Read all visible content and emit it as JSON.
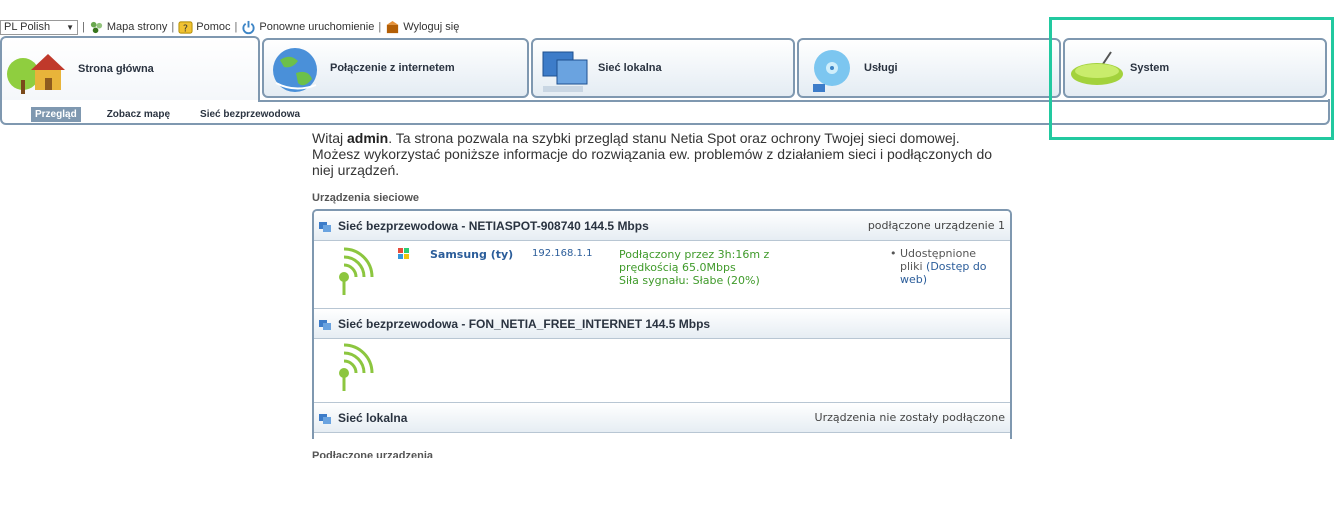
{
  "topbar": {
    "language": "PL Polish",
    "links": [
      {
        "label": "Mapa strony",
        "icon": "sitemap-icon"
      },
      {
        "label": "Pomoc",
        "icon": "help-icon"
      },
      {
        "label": "Ponowne uruchomienie",
        "icon": "power-icon"
      },
      {
        "label": "Wyloguj się",
        "icon": "logout-icon"
      }
    ]
  },
  "tabs": [
    {
      "label": "Strona główna",
      "icon": "home-icon",
      "active": true
    },
    {
      "label": "Połączenie z internetem",
      "icon": "globe-icon"
    },
    {
      "label": "Sieć lokalna",
      "icon": "local-network-icon"
    },
    {
      "label": "Usługi",
      "icon": "services-icon"
    },
    {
      "label": "System",
      "icon": "router-icon"
    }
  ],
  "subnav": [
    "Przegląd",
    "Zobacz mapę",
    "Sieć bezprzewodowa"
  ],
  "intro": {
    "prefix": "Witaj ",
    "user": "admin",
    "text": ". Ta strona pozwala na szybki przegląd stanu Netia Spot oraz ochrony Twojej sieci domowej. Możesz wykorzystać poniższe informacje do rozwiązania ew. problemów z działaniem sieci i podłączonych do niej urządzeń."
  },
  "network_devices": {
    "title": "Urządzenia sieciowe",
    "networks": [
      {
        "name": "Sieć bezprzewodowa - NETIASPOT-908740 144.5 Mbps",
        "status": "podłączone urządzenie 1",
        "device": {
          "name": "Samsung (ty)",
          "ip": "192.168.1.1",
          "status_line1": "Podłączony przez 3h:16m z prędkością 65.0Mbps",
          "status_line2": "Siła sygnału: Słabe (20%)",
          "shares_text": "Udostępnione pliki",
          "shares_link": "(Dostęp do web)"
        }
      },
      {
        "name": "Sieć bezprzewodowa - FON_NETIA_FREE_INTERNET 144.5 Mbps",
        "status": ""
      },
      {
        "name": "Sieć lokalna",
        "status": "Urządzenia nie zostały podłączone"
      }
    ]
  },
  "connected_title": "Podłączone urządzenia",
  "colors": {
    "border": "#7f98b0",
    "highlight": "#22c9a0",
    "link": "#2b5d9a",
    "status": "#3f9a2a"
  }
}
